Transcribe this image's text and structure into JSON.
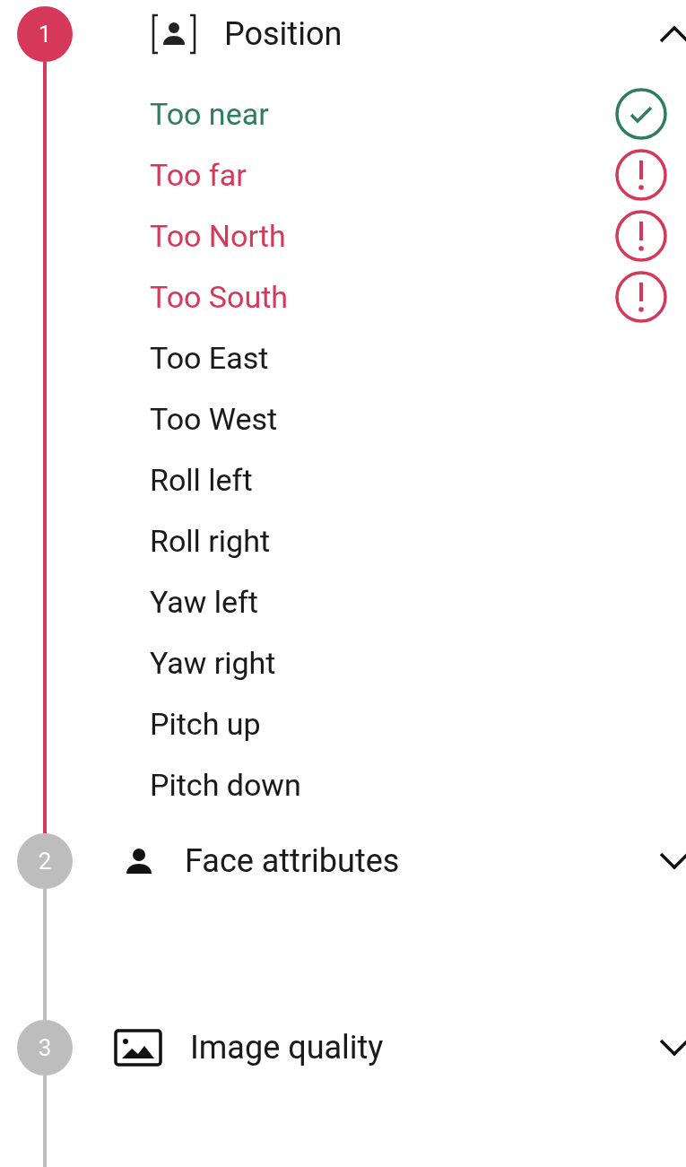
{
  "steps": [
    {
      "number": "1",
      "title": "Position",
      "active": true,
      "expanded": true,
      "items": [
        {
          "label": "Too near",
          "kind": "pass"
        },
        {
          "label": "Too far",
          "kind": "fail"
        },
        {
          "label": "Too North",
          "kind": "fail"
        },
        {
          "label": "Too South",
          "kind": "fail"
        },
        {
          "label": "Too East",
          "kind": "plain"
        },
        {
          "label": "Too West",
          "kind": "plain"
        },
        {
          "label": "Roll left",
          "kind": "plain"
        },
        {
          "label": "Roll right",
          "kind": "plain"
        },
        {
          "label": "Yaw left",
          "kind": "plain"
        },
        {
          "label": "Yaw right",
          "kind": "plain"
        },
        {
          "label": "Pitch up",
          "kind": "plain"
        },
        {
          "label": "Pitch down",
          "kind": "plain"
        }
      ]
    },
    {
      "number": "2",
      "title": "Face attributes",
      "active": false,
      "expanded": false
    },
    {
      "number": "3",
      "title": "Image quality",
      "active": false,
      "expanded": false
    }
  ]
}
